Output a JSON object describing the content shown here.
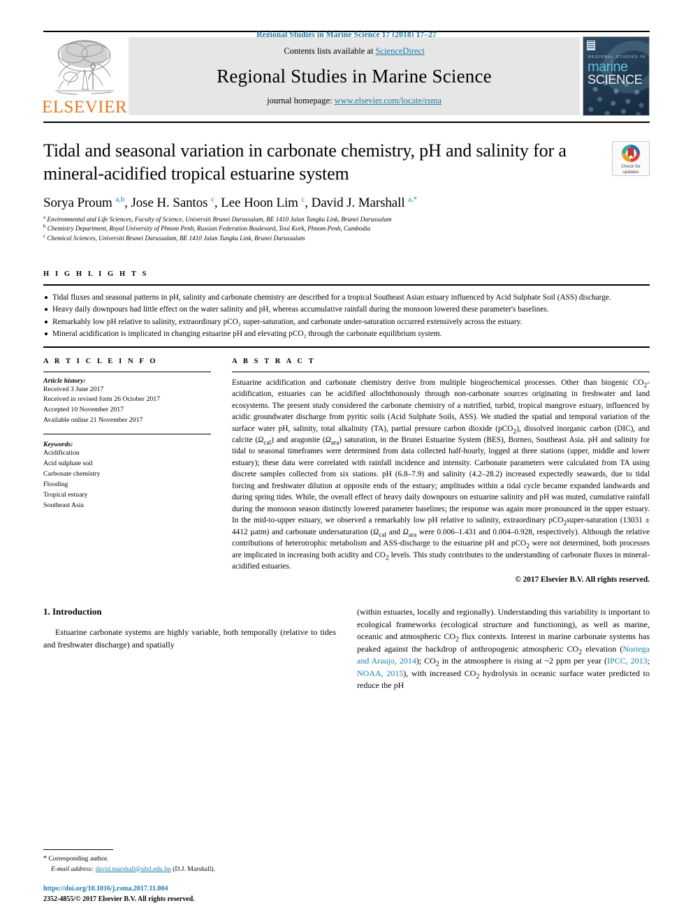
{
  "running_head": "Regional Studies in Marine Science 17 (2018) 17–27",
  "masthead": {
    "publisher_logo_text": "ELSEVIER",
    "contents_prefix": "Contents lists available at ",
    "contents_link": "ScienceDirect",
    "journal_name": "Regional Studies in Marine Science",
    "homepage_prefix": "journal homepage: ",
    "homepage_url": "www.elsevier.com/locate/rsma",
    "cover": {
      "line1": "REGIONAL STUDIES IN",
      "line2": "marine",
      "line3": "SCIENCE"
    }
  },
  "article": {
    "title": "Tidal and seasonal variation in carbonate chemistry, pH and salinity for a mineral-acidified tropical estuarine system",
    "crossmark_label_line1": "Check for",
    "crossmark_label_line2": "updates",
    "authors_html": "Sorya Proum <sup>a,b</sup>, Jose H. Santos <sup>c</sup>, Lee Hoon Lim <sup>c</sup>, David J. Marshall <sup>a,*</sup>",
    "affiliations": [
      {
        "mark": "a",
        "text": "Environmental and Life Sciences, Faculty of Science, Universiti Brunei Darussalam, BE 1410 Jalan Tungku Link, Brunei Darussalam"
      },
      {
        "mark": "b",
        "text": "Chemistry Department, Royal University of Phnom Penh, Russian Federation Boulevard, Toul Kork, Phnom Penh, Cambodia"
      },
      {
        "mark": "c",
        "text": "Chemical Sciences, Universiti Brunei Darussalam, BE 1410 Jalan Tungku Link, Brunei Darussalam"
      }
    ]
  },
  "highlights": {
    "heading": "H I G H L I G H T S",
    "items": [
      "Tidal fluxes and seasonal patterns in pH, salinity and carbonate chemistry are described for a tropical Southeast Asian estuary influenced by Acid Sulphate Soil (ASS) discharge.",
      "Heavy daily downpours had little effect on the water salinity and pH, whereas accumulative rainfall during the monsoon lowered these parameter's baselines.",
      "Remarkably low pH relative to salinity, extraordinary pCO₂ super-saturation, and carbonate under-saturation occurred extensively across the estuary.",
      "Mineral acidification is implicated in changing estuarine pH and elevating pCO₂ through the carbonate equilibrium system."
    ]
  },
  "article_info": {
    "heading": "A R T I C L E   I N F O",
    "history_label": "Article history:",
    "history": [
      "Received 3 June 2017",
      "Received in revised form 26 October 2017",
      "Accepted 10 November 2017",
      "Available online 21 November 2017"
    ],
    "keywords_label": "Keywords:",
    "keywords": [
      "Acidification",
      "Acid sulphate soil",
      "Carbonate chemistry",
      "Flooding",
      "Tropical estuary",
      "Southeast Asia"
    ]
  },
  "abstract": {
    "heading": "A B S T R A C T",
    "text_html": "Estuarine acidification and carbonate chemistry derive from multiple biogeochemical processes. Other than biogenic CO<sub>2</sub>-acidification, estuaries can be acidified allochthonously through non-carbonate sources originating in freshwater and land ecosystems. The present study considered the carbonate chemistry of a nutrified, turbid, tropical mangrove estuary, influenced by acidic groundwater discharge from pyritic soils (Acid Sulphate Soils, ASS). We studied the spatial and temporal variation of the surface water pH, salinity, total alkalinity (TA), partial pressure carbon dioxide (pCO<sub>2</sub>), dissolved inorganic carbon (DIC), and calcite (<i>&#937;</i><sub>cal</sub>) and aragonite (<i>&#937;</i><sub>ara</sub>) saturation, in the Brunei Estuarine System (BES), Borneo, Southeast Asia. pH and salinity for tidal to seasonal timeframes were determined from data collected half-hourly, logged at three stations (upper, middle and lower estuary); these data were correlated with rainfall incidence and intensity. Carbonate parameters were calculated from TA using discrete samples collected from six stations. pH (6.8–7.9) and salinity (4.2–28.2) increased expectedly seawards, due to tidal forcing and freshwater dilution at opposite ends of the estuary; amplitudes within a tidal cycle became expanded landwards and during spring tides. While, the overall effect of heavy daily downpours on estuarine salinity and pH was muted, cumulative rainfall during the monsoon season distinctly lowered parameter baselines; the response was again more pronounced in the upper estuary. In the mid-to-upper estuary, we observed a remarkably low pH relative to salinity, extraordinary pCO<sub>2</sub>super-saturation (13031 ± 4412 µatm) and carbonate undersaturation (<i>&#937;</i><sub>cal</sub> and <i>&#937;</i><sub>ara</sub> were 0.006–1.431 and 0.004–0.928, respectively). Although the relative contributions of heterotrophic metabolism and ASS-discharge to the estuarine pH and pCO<sub>2</sub> were not determined, both processes are implicated in increasing both acidity and CO<sub>2</sub> levels. This study contributes to the understanding of carbonate fluxes in mineral-acidified estuaries.",
    "copyright": "© 2017 Elsevier B.V. All rights reserved."
  },
  "introduction": {
    "section_number_title": "1. Introduction",
    "left_paragraph": "Estuarine carbonate systems are highly variable, both temporally (relative to tides and freshwater discharge) and spatially",
    "right_paragraph_html": "(within estuaries, locally and regionally). Understanding this variability is important to ecological frameworks (ecological structure and functioning), as well as marine, oceanic and atmospheric CO<sub>2</sub> flux contexts. Interest in marine carbonate systems has peaked against the backdrop of anthropogenic atmospheric CO<sub>2</sub> elevation (<span class=\"lnk\">Noriega and Araujo, 2014</span>); CO<sub>2</sub> in the atmosphere is rising at ~2 ppm per year (<span class=\"lnk\">IPCC, 2013</span>; <span class=\"lnk\">NOAA, 2015</span>), with increased CO<sub>2</sub> hydrolysis in oceanic surface water predicted to reduce the pH"
  },
  "footnote": {
    "corresponding_marker": "*",
    "corresponding_text": "Corresponding author.",
    "email_label": "E-mail address:",
    "email": "david.marshall@ubd.edu.bn",
    "email_owner": "(D.J. Marshall).",
    "doi": "https://doi.org/10.1016/j.rsma.2017.11.004",
    "issn_copyright": "2352-4855/© 2017 Elsevier B.V. All rights reserved."
  },
  "colors": {
    "link": "#1a7ba8",
    "elsevier_orange": "#E87722",
    "masthead_bg": "#e6e6e6"
  }
}
